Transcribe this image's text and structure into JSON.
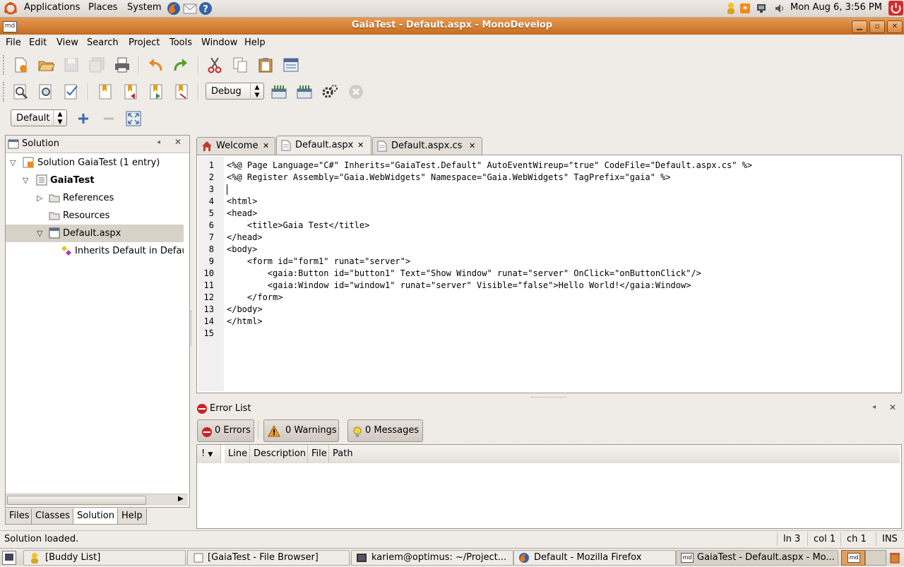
{
  "panel_top": {
    "menus": [
      "Applications",
      "Places",
      "System"
    ],
    "clock": "Mon Aug  6,  3:56 PM"
  },
  "window": {
    "title": "GaiaTest - Default.aspx - MonoDevelop",
    "app_badge": "md"
  },
  "menubar": [
    "File",
    "Edit",
    "View",
    "Search",
    "Project",
    "Tools",
    "Window",
    "Help"
  ],
  "toolbar": {
    "config_value": "Debug",
    "layout_value": "Default"
  },
  "solution_pane": {
    "title": "Solution",
    "tree": [
      {
        "label": "Solution GaiaTest (1 entry)"
      },
      {
        "label": "GaiaTest"
      },
      {
        "label": "References"
      },
      {
        "label": "Resources"
      },
      {
        "label": "Default.aspx"
      },
      {
        "label": "Inherits Default in Default"
      }
    ],
    "tabs": [
      "Files",
      "Classes",
      "Solution",
      "Help"
    ]
  },
  "editor": {
    "tabs": [
      {
        "label": "Welcome"
      },
      {
        "label": "Default.aspx"
      },
      {
        "label": "Default.aspx.cs"
      }
    ],
    "lines": [
      "<%@ Page Language=\"C#\" Inherits=\"GaiaTest.Default\" AutoEventWireup=\"true\" CodeFile=\"Default.aspx.cs\" %>",
      "<%@ Register Assembly=\"Gaia.WebWidgets\" Namespace=\"Gaia.WebWidgets\" TagPrefix=\"gaia\" %>",
      "",
      "<html>",
      "<head>",
      "    <title>Gaia Test</title>",
      "</head>",
      "<body>",
      "    <form id=\"form1\" runat=\"server\">",
      "        <gaia:Button id=\"button1\" Text=\"Show Window\" runat=\"server\" OnClick=\"onButtonClick\"/>",
      "        <gaia:Window id=\"window1\" runat=\"server\" Visible=\"false\">Hello World!</gaia:Window>",
      "    </form>",
      "</body>",
      "</html>",
      ""
    ],
    "line_numbers": [
      "1",
      "2",
      "3",
      "4",
      "5",
      "6",
      "7",
      "8",
      "9",
      "10",
      "11",
      "12",
      "13",
      "14",
      "15"
    ]
  },
  "error_list": {
    "title": "Error List",
    "errors_label": "0 Errors",
    "warnings_label": "0 Warnings",
    "messages_label": "0 Messages",
    "columns": [
      "!",
      "Line",
      "Description",
      "File",
      "Path"
    ]
  },
  "status": {
    "message": "Solution loaded.",
    "line": "ln 3",
    "col": "col 1",
    "ch": "ch 1",
    "mode": "INS"
  },
  "taskbar": [
    {
      "label": "[Buddy List]"
    },
    {
      "label": "[GaiaTest - File Browser]"
    },
    {
      "label": "kariem@optimus: ~/Project..."
    },
    {
      "label": "Default - Mozilla Firefox"
    },
    {
      "label": "GaiaTest - Default.aspx - Mo..."
    }
  ],
  "colors": {
    "titlebar": "#d07a30",
    "panel": "#efebe7",
    "selection": "#d7d1c8"
  }
}
